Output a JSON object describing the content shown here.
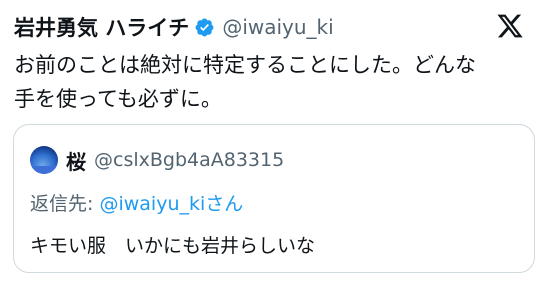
{
  "author": {
    "display_name": "岩井勇気 ハライチ",
    "handle": "@iwaiyu_ki",
    "verified_icon": "verified-badge-icon",
    "verified_color": "#1d9bf0"
  },
  "platform_icon": "x-logo-icon",
  "tweet": {
    "text": "お前のことは絶対に特定することにした。どんな\n手を使っても必ずに。"
  },
  "quoted_tweet": {
    "avatar_icon": "avatar",
    "display_name": "桜",
    "handle": "@cslxBgb4aA83315",
    "reply_prefix": "返信先: ",
    "reply_target": "@iwaiyu_ki",
    "reply_suffix": "さん",
    "text": "キモい服　いかにも岩井らしいな"
  },
  "colors": {
    "text": "#0f1419",
    "secondary": "#536471",
    "link": "#1d9bf0",
    "border": "#cfd9de"
  }
}
